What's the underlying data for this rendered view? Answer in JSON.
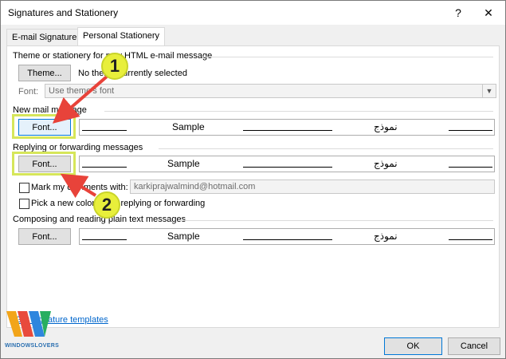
{
  "window": {
    "title": "Signatures and Stationery",
    "help": "?",
    "close": "✕"
  },
  "tabs": [
    {
      "label": "E-mail Signature",
      "active": false
    },
    {
      "label": "Personal Stationery",
      "active": true
    }
  ],
  "theme_section": {
    "heading": "Theme or stationery for new HTML e-mail message",
    "theme_button": "Theme...",
    "status": "No theme currently selected",
    "font_label": "Font:",
    "font_value": "Use theme's font"
  },
  "new_mail": {
    "heading": "New mail message",
    "font_button": "Font...",
    "sample": "Sample",
    "arabic_sample": "نموذج"
  },
  "reply": {
    "heading": "Replying or forwarding messages",
    "font_button": "Font...",
    "sample": "Sample",
    "arabic_sample": "نموذج",
    "mark_comments_label": "Mark my comments with:",
    "mark_comments_value": "karkiprajwalmind@hotmail.com",
    "mark_comments_checked": false,
    "pick_color_label": "Pick a new color when replying or forwarding",
    "pick_color_checked": false
  },
  "plain_text": {
    "heading": "Composing and reading plain text messages",
    "font_button": "Font...",
    "sample": "Sample",
    "arabic_sample": "نموذج"
  },
  "footer": {
    "link_text": "Get signature templates",
    "ok": "OK",
    "cancel": "Cancel"
  },
  "annotations": [
    {
      "number": "1"
    },
    {
      "number": "2"
    }
  ],
  "watermark": {
    "text": "WINDOWSLOVERS"
  },
  "colors": {
    "highlight": "#d6e65a",
    "badge": "#e8ef3b",
    "arrow": "#e8433a",
    "link": "#0066cc"
  }
}
